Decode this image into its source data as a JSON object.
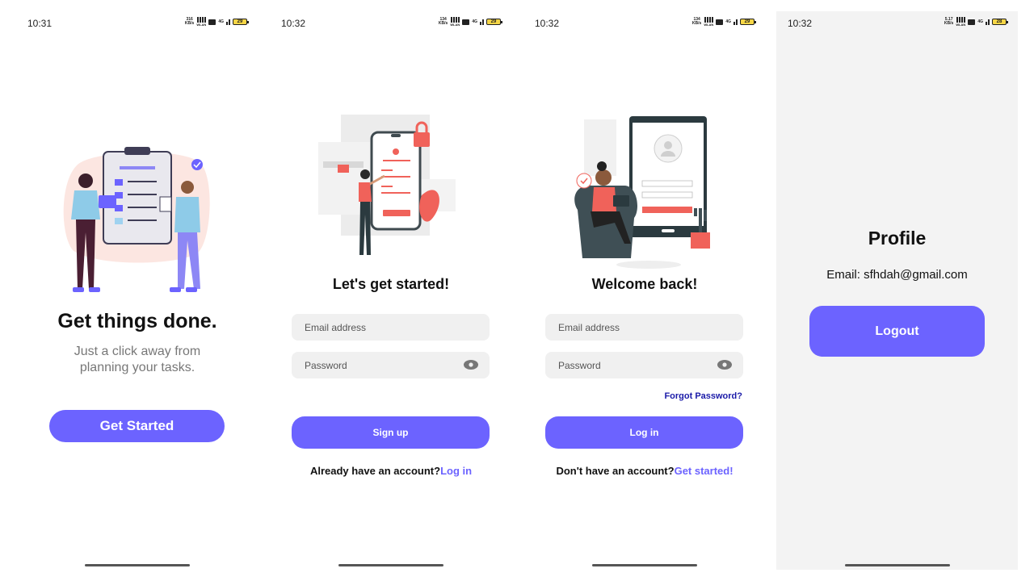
{
  "status_bars": [
    {
      "time": "10:31",
      "speed": "316",
      "speed_unit": "KB/s",
      "wlan": "WLAN",
      "net": "4G",
      "battery": "29"
    },
    {
      "time": "10:32",
      "speed": "134",
      "speed_unit": "KB/s",
      "wlan": "WLAN",
      "net": "4G",
      "battery": "29"
    },
    {
      "time": "10:32",
      "speed": "134",
      "speed_unit": "KB/s",
      "wlan": "WLAN",
      "net": "4G",
      "battery": "29"
    },
    {
      "time": "10:32",
      "speed": "5.17",
      "speed_unit": "KB/s",
      "wlan": "WLAN",
      "net": "4G",
      "battery": "28"
    }
  ],
  "onboarding": {
    "title": "Get things done.",
    "subtitle_line1": "Just a click away from",
    "subtitle_line2": "planning your tasks.",
    "button": "Get Started"
  },
  "signup": {
    "title": "Let's get started!",
    "email_placeholder": "Email address",
    "password_placeholder": "Password",
    "button": "Sign up",
    "prompt": "Already have an account?",
    "link": "Log in"
  },
  "login": {
    "title": "Welcome back!",
    "email_placeholder": "Email address",
    "password_placeholder": "Password",
    "forgot": "Forgot Password?",
    "button": "Log in",
    "prompt": "Don't have an account?",
    "link": "Get started!"
  },
  "profile": {
    "title": "Profile",
    "email_label": "Email:",
    "email_value": "sfhdah@gmail.com",
    "button": "Logout"
  },
  "colors": {
    "accent": "#6c63ff",
    "forgot_link": "#1a1aa8",
    "illustration_red": "#f0625a"
  }
}
